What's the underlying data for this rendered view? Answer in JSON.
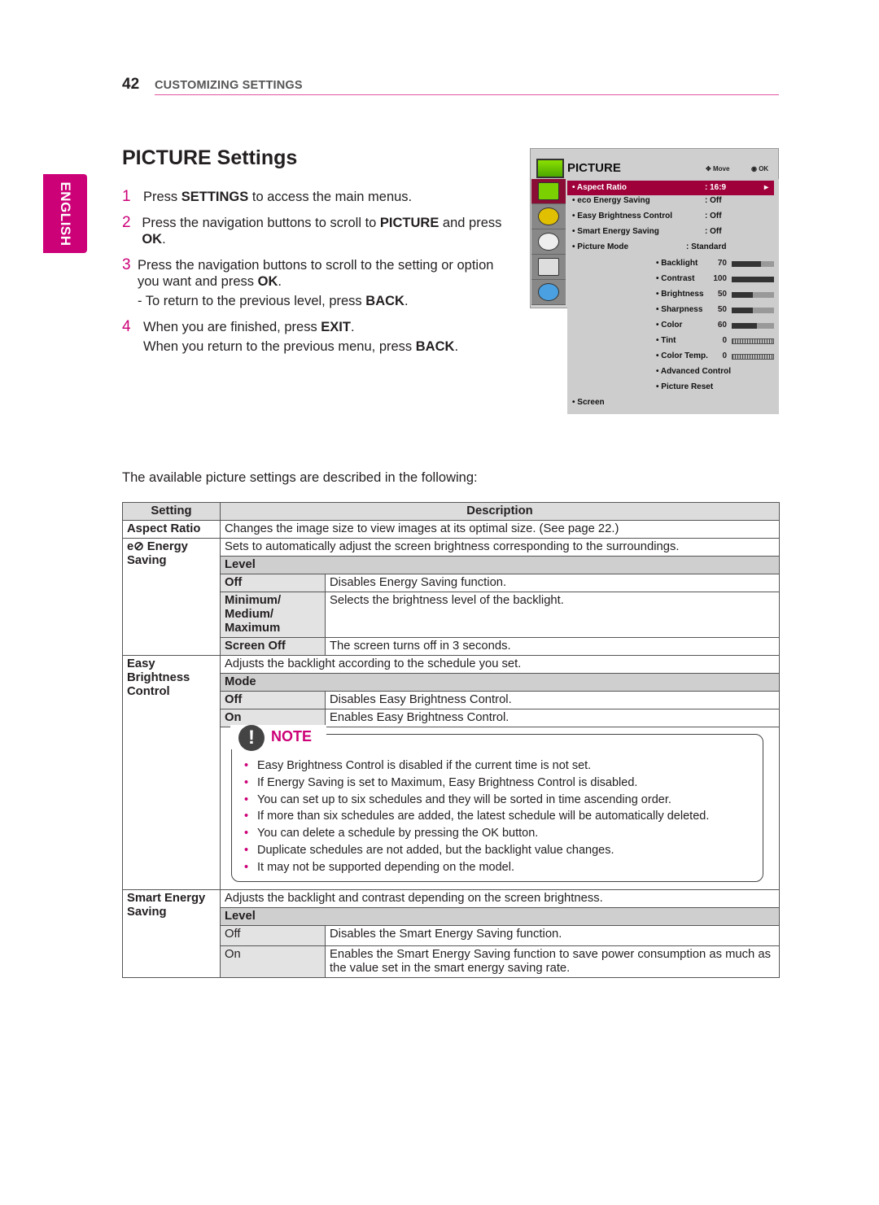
{
  "header": {
    "page_number": "42",
    "section": "CUSTOMIZING SETTINGS"
  },
  "language_tab": "ENGLISH",
  "title": "PICTURE Settings",
  "steps": [
    {
      "n": "1",
      "parts": [
        [
          "Press ",
          0
        ],
        [
          "SETTINGS",
          1
        ],
        [
          " to access the main menus.",
          0
        ]
      ]
    },
    {
      "n": "2",
      "parts": [
        [
          "Press the navigation buttons to scroll to ",
          0
        ],
        [
          "PICTURE",
          1
        ],
        [
          " and press ",
          0
        ],
        [
          "OK",
          1
        ],
        [
          ".",
          0
        ]
      ]
    },
    {
      "n": "3",
      "parts": [
        [
          "Press the navigation buttons to scroll to the setting or option you want and press ",
          0
        ],
        [
          "OK",
          1
        ],
        [
          ".",
          0
        ]
      ],
      "sub": [
        [
          "- To return to the previous level, press ",
          0
        ],
        [
          "BACK",
          1
        ],
        [
          ".",
          0
        ]
      ]
    },
    {
      "n": "4",
      "parts": [
        [
          "When you are finished, press ",
          0
        ],
        [
          "EXIT",
          1
        ],
        [
          ".",
          0
        ]
      ],
      "sub": [
        [
          "When you return to the previous menu, press ",
          0
        ],
        [
          "BACK",
          1
        ],
        [
          ".",
          0
        ]
      ]
    }
  ],
  "tv_menu": {
    "title": "PICTURE",
    "hint_move": "Move",
    "hint_ok": "OK",
    "side_icons": [
      "picture-icon",
      "audio-icon",
      "clock-icon",
      "option-icon",
      "network-icon"
    ],
    "items": [
      {
        "label": "• Aspect Ratio",
        "value": ": 16:9",
        "selected": true
      },
      {
        "label": "• eco Energy Saving",
        "value": ": Off"
      },
      {
        "label": "• Easy Brightness Control",
        "value": ": Off"
      },
      {
        "label": "• Smart Energy Saving",
        "value": ": Off"
      },
      {
        "label": "• Picture Mode",
        "value": ": Standard"
      }
    ],
    "sliders": [
      {
        "label": "• Backlight",
        "value": "70",
        "fill": 70
      },
      {
        "label": "• Contrast",
        "value": "100",
        "fill": 100
      },
      {
        "label": "• Brightness",
        "value": "50",
        "fill": 50
      },
      {
        "label": "• Sharpness",
        "value": "50",
        "fill": 50
      },
      {
        "label": "• Color",
        "value": "60",
        "fill": 60
      },
      {
        "label": "• Tint",
        "value": "0",
        "fill": null
      },
      {
        "label": "• Color Temp.",
        "value": "0",
        "fill": null
      }
    ],
    "sub_items": [
      "• Advanced Control",
      "• Picture Reset"
    ],
    "last_item": "• Screen",
    "accent": "#a0003a"
  },
  "intro": "The available picture settings are described in the following:",
  "table": {
    "headers": [
      "Setting",
      "Description"
    ],
    "aspect": {
      "name": "Aspect Ratio",
      "desc": "Changes the image size to view images at its optimal size. (See page 22.)"
    },
    "energy": {
      "name": "Energy Saving",
      "desc": "Sets to automatically adjust the screen brightness corresponding to the surroundings.",
      "level": "Level",
      "rows": [
        [
          "Off",
          "Disables Energy Saving function."
        ],
        [
          "Minimum/ Medium/ Maximum",
          "Selects the brightness level of the backlight."
        ],
        [
          "Screen Off",
          "The screen turns off in 3 seconds."
        ]
      ]
    },
    "easy": {
      "name": "Easy Brightness Control",
      "desc": "Adjusts the backlight according to the schedule you set.",
      "level": "Mode",
      "rows": [
        [
          "Off",
          "Disables Easy Brightness Control."
        ],
        [
          "On",
          "Enables Easy Brightness Control."
        ]
      ]
    },
    "note": {
      "title": "NOTE",
      "items": [
        "Easy Brightness Control is disabled if the current time is not set.",
        "If Energy Saving is set to Maximum, Easy Brightness Control is disabled.",
        "You can set up to six schedules and they will be sorted in time ascending order.",
        "If more than six schedules are added, the latest schedule will be automatically deleted.",
        "You can delete a schedule by pressing the OK button.",
        "Duplicate schedules are not added, but the backlight value changes.",
        "It may not be supported depending on the model."
      ]
    },
    "smart": {
      "name": "Smart Energy Saving",
      "desc": "Adjusts the backlight and contrast depending on the screen brightness.",
      "level": "Level",
      "rows": [
        [
          "Off",
          "Disables the Smart Energy Saving function."
        ],
        [
          "On",
          "Enables the Smart Energy Saving function to save power consumption as much as the value set in the smart energy saving rate."
        ]
      ]
    }
  }
}
